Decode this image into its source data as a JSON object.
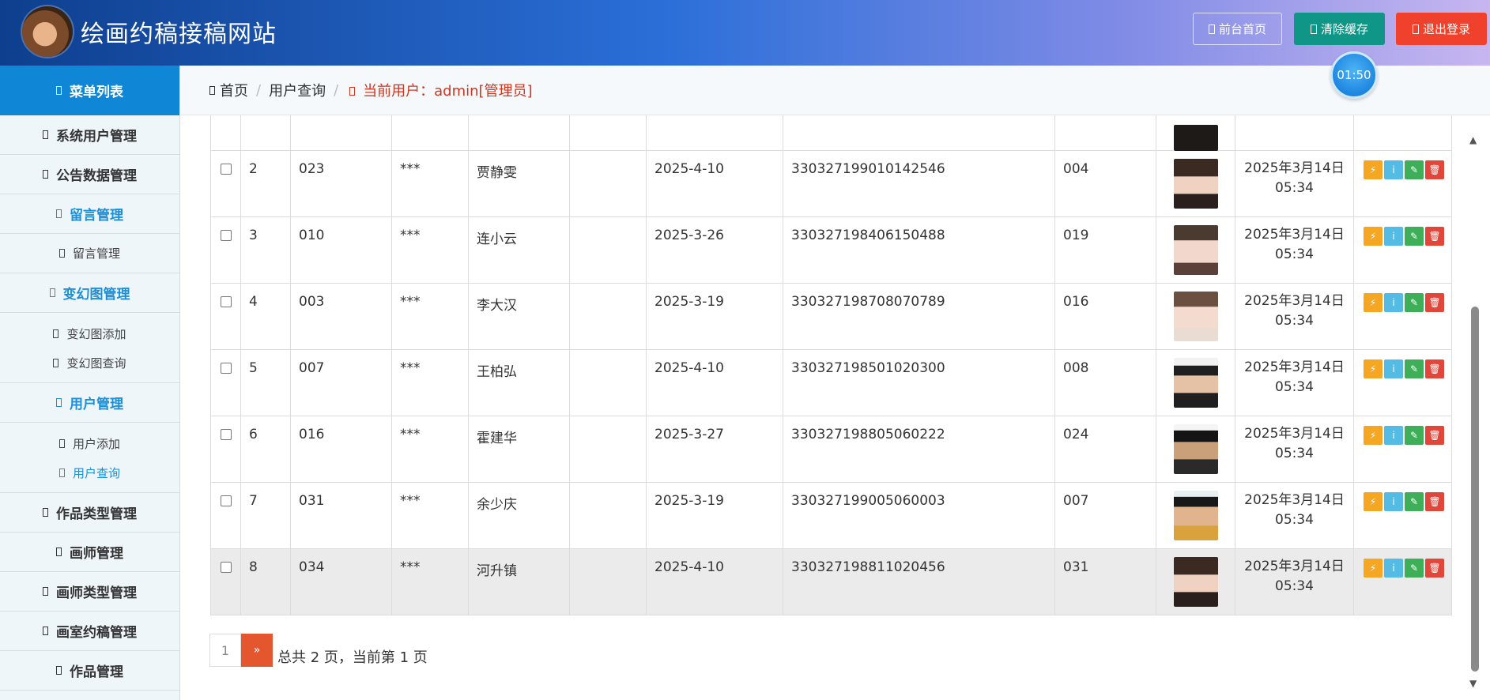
{
  "header": {
    "title": "绘画约稿接稿网站",
    "buttons": {
      "home": "前台首页",
      "clear_cache": "清除缓存",
      "logout": "退出登录"
    },
    "timer": "01:50"
  },
  "sidebar": {
    "menu_title": "菜单列表",
    "items": [
      {
        "label": "系统用户管理"
      },
      {
        "label": "公告数据管理"
      },
      {
        "label": "留言管理"
      },
      {
        "label": "留言管理"
      },
      {
        "label": "变幻图管理"
      },
      {
        "label": "变幻图添加"
      },
      {
        "label": "变幻图查询"
      },
      {
        "label": "用户管理"
      },
      {
        "label": "用户添加"
      },
      {
        "label": "用户查询"
      },
      {
        "label": "作品类型管理"
      },
      {
        "label": "画师管理"
      },
      {
        "label": "画师类型管理"
      },
      {
        "label": "画室约稿管理"
      },
      {
        "label": "作品管理"
      }
    ]
  },
  "breadcrumb": {
    "home": "首页",
    "page": "用户查询",
    "current_user": "当前用户：admin[管理员]"
  },
  "table": {
    "rows": [
      {
        "idx": "2",
        "account": "023",
        "password": "***",
        "name": "贾静雯",
        "date": "2025-4-10",
        "id_card": "330327199010142546",
        "code": "004",
        "time_line1": "2025年3月14日",
        "time_line2": "05:34"
      },
      {
        "idx": "3",
        "account": "010",
        "password": "***",
        "name": "连小云",
        "date": "2025-3-26",
        "id_card": "330327198406150488",
        "code": "019",
        "time_line1": "2025年3月14日",
        "time_line2": "05:34"
      },
      {
        "idx": "4",
        "account": "003",
        "password": "***",
        "name": "李大汉",
        "date": "2025-3-19",
        "id_card": "330327198708070789",
        "code": "016",
        "time_line1": "2025年3月14日",
        "time_line2": "05:34"
      },
      {
        "idx": "5",
        "account": "007",
        "password": "***",
        "name": "王柏弘",
        "date": "2025-4-10",
        "id_card": "330327198501020300",
        "code": "008",
        "time_line1": "2025年3月14日",
        "time_line2": "05:34"
      },
      {
        "idx": "6",
        "account": "016",
        "password": "***",
        "name": "霍建华",
        "date": "2025-3-27",
        "id_card": "330327198805060222",
        "code": "024",
        "time_line1": "2025年3月14日",
        "time_line2": "05:34"
      },
      {
        "idx": "7",
        "account": "031",
        "password": "***",
        "name": "余少庆",
        "date": "2025-3-19",
        "id_card": "330327199005060003",
        "code": "007",
        "time_line1": "2025年3月14日",
        "time_line2": "05:34"
      },
      {
        "idx": "8",
        "account": "034",
        "password": "***",
        "name": "河升镇",
        "date": "2025-4-10",
        "id_card": "330327198811020456",
        "code": "031",
        "time_line1": "2025年3月14日",
        "time_line2": "05:34"
      }
    ]
  },
  "pager": {
    "page1": "1",
    "next": "»",
    "info": "总共 2 页，当前第 1 页"
  },
  "icons": {
    "action_buttons": [
      "bolt-icon",
      "info-icon",
      "pencil-icon",
      "trash-icon"
    ]
  },
  "colors": {
    "header_dark": "#0e3f8e",
    "menu_blue": "#0f86d6",
    "teal": "#0f9686",
    "red": "#f0412c",
    "pager_active": "#e4572e"
  }
}
